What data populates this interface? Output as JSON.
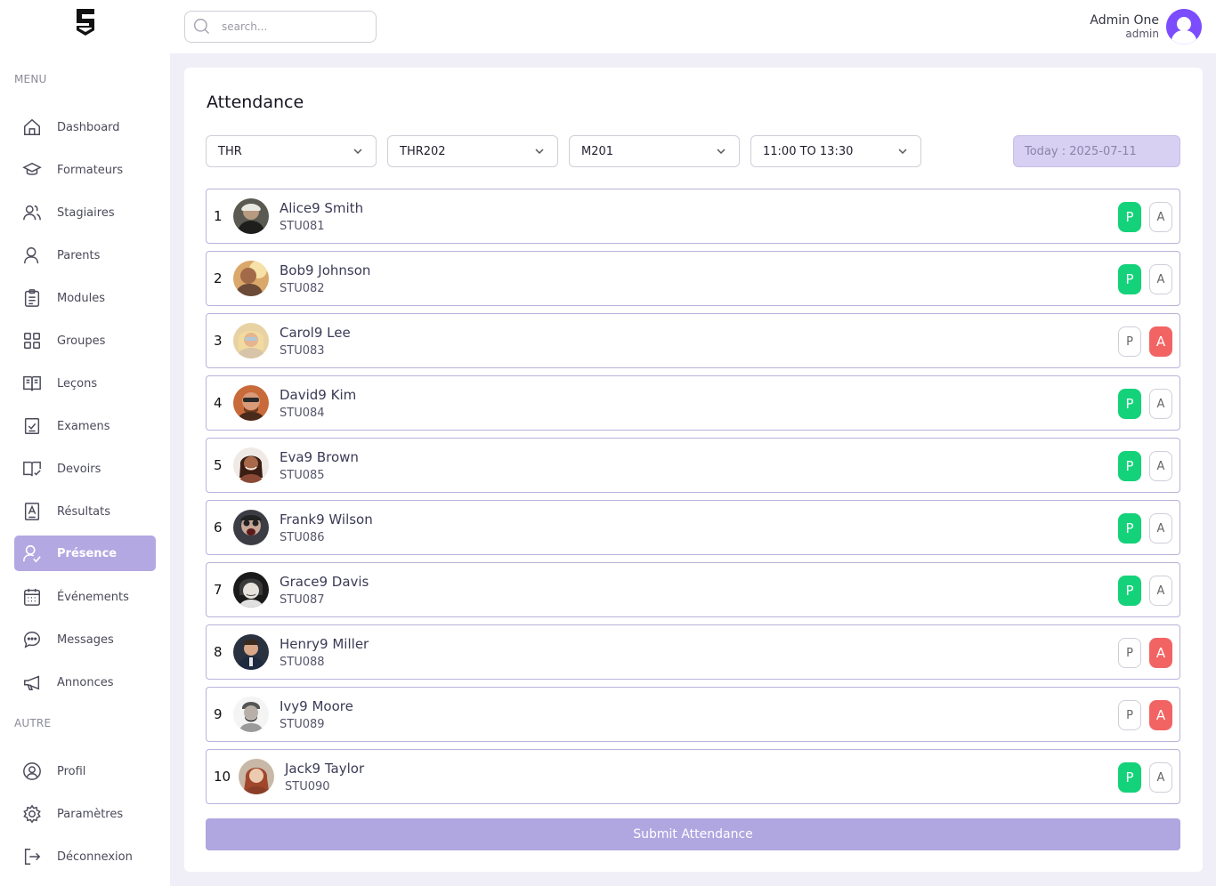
{
  "sidebar": {
    "menu_label": "MENU",
    "other_label": "AUTRE",
    "items": [
      {
        "label": "Dashboard",
        "icon": "home-icon"
      },
      {
        "label": "Formateurs",
        "icon": "graduation-cap-icon"
      },
      {
        "label": "Stagiaires",
        "icon": "users-icon"
      },
      {
        "label": "Parents",
        "icon": "user-pair-icon"
      },
      {
        "label": "Modules",
        "icon": "clipboard-icon"
      },
      {
        "label": "Groupes",
        "icon": "grid-icon"
      },
      {
        "label": "Leçons",
        "icon": "book-open-icon"
      },
      {
        "label": "Examens",
        "icon": "checkbox-icon"
      },
      {
        "label": "Devoirs",
        "icon": "book-check-icon"
      },
      {
        "label": "Résultats",
        "icon": "grade-icon"
      },
      {
        "label": "Présence",
        "icon": "user-check-icon",
        "active": true
      },
      {
        "label": "Événements",
        "icon": "calendar-icon"
      },
      {
        "label": "Messages",
        "icon": "chat-icon"
      },
      {
        "label": "Annonces",
        "icon": "megaphone-icon"
      }
    ],
    "other_items": [
      {
        "label": "Profil",
        "icon": "profile-icon"
      },
      {
        "label": "Paramètres",
        "icon": "gear-icon"
      },
      {
        "label": "Déconnexion",
        "icon": "logout-icon"
      }
    ]
  },
  "topbar": {
    "search_placeholder": "search...",
    "user_name": "Admin One",
    "user_role": "admin"
  },
  "attendance": {
    "title": "Attendance",
    "filters": {
      "branch": "THR",
      "group": "THR202",
      "module": "M201",
      "time_slot": "11:00 TO 13:30"
    },
    "today": "Today : 2025-07-11",
    "present_label": "P",
    "absent_label": "A",
    "students": [
      {
        "index": "1",
        "name": "Alice9 Smith",
        "id": "STU081",
        "status": "present"
      },
      {
        "index": "2",
        "name": "Bob9 Johnson",
        "id": "STU082",
        "status": "present"
      },
      {
        "index": "3",
        "name": "Carol9 Lee",
        "id": "STU083",
        "status": "absent"
      },
      {
        "index": "4",
        "name": "David9 Kim",
        "id": "STU084",
        "status": "present"
      },
      {
        "index": "5",
        "name": "Eva9 Brown",
        "id": "STU085",
        "status": "present"
      },
      {
        "index": "6",
        "name": "Frank9 Wilson",
        "id": "STU086",
        "status": "present"
      },
      {
        "index": "7",
        "name": "Grace9 Davis",
        "id": "STU087",
        "status": "present"
      },
      {
        "index": "8",
        "name": "Henry9 Miller",
        "id": "STU088",
        "status": "absent"
      },
      {
        "index": "9",
        "name": "Ivy9 Moore",
        "id": "STU089",
        "status": "absent"
      },
      {
        "index": "10",
        "name": "Jack9 Taylor",
        "id": "STU090",
        "status": "present"
      }
    ],
    "submit_label": "Submit Attendance"
  },
  "colors": {
    "accent": "#b3a8e2",
    "present": "#14d27a",
    "absent": "#f26464"
  }
}
